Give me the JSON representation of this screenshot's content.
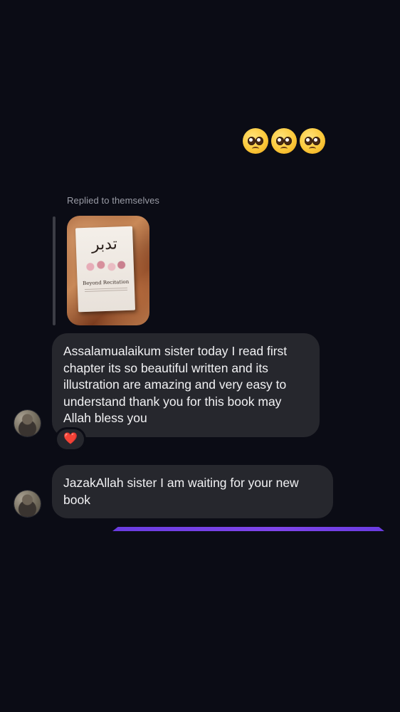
{
  "conversation": {
    "emoji_reaction": {
      "glyphs": [
        "🥺",
        "🥺",
        "🥺"
      ]
    },
    "reply": {
      "label": "Replied to themselves",
      "image": {
        "title_glyph": "تدبر",
        "subtitle": "Beyond Recitation"
      }
    },
    "messages": [
      {
        "text": "Assalamualaikum sister today I read first chapter its so beautiful written and its illustration are amazing and very easy to understand thank you for this book may Allah bless you",
        "reaction": "❤️"
      },
      {
        "text": "JazakAllah sister I am waiting for your new book"
      }
    ]
  },
  "colors": {
    "background": "#0b0c15",
    "bubble": "#26272d",
    "text": "#f2f2f4",
    "muted": "#9a9ca6",
    "accent": "#7f45ea",
    "heart": "#ff2d4a"
  },
  "icons": {
    "avatar": "user-avatar",
    "reaction": "heart-icon",
    "emoji": "pleading-face-emoji"
  }
}
